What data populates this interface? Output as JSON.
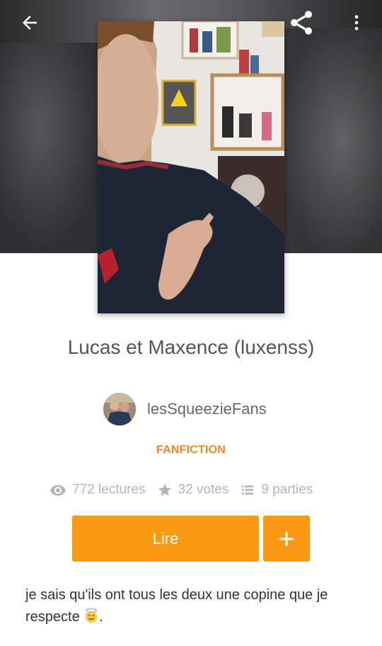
{
  "story": {
    "title": "Lucas et Maxence (luxenss)",
    "author": "lesSqueezieFans",
    "category": "FANFICTION",
    "reads": "772 lectures",
    "votes": "32 votes",
    "parts": "9 parties",
    "description": "je sais qu'ils ont tous les deux une copine que je respecte",
    "description_end": "."
  },
  "actions": {
    "read_label": "Lire"
  },
  "icons": {
    "back": "arrow-left-icon",
    "share": "share-icon",
    "more": "more-vertical-icon",
    "reads": "eye-icon",
    "votes": "star-icon",
    "parts": "list-icon",
    "add": "plus-icon",
    "emoji": "smiling-face-with-halo-emoji"
  },
  "colors": {
    "accent": "#fb9a12",
    "category": "#f5871f",
    "muted": "#b5b5b5"
  }
}
